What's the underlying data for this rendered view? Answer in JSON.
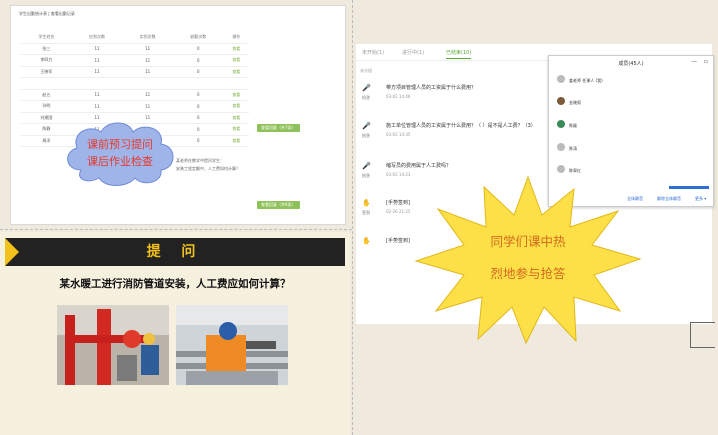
{
  "top_left": {
    "tabs": "学生出勤统计表 | 查看出勤记录",
    "columns": [
      "学生姓名",
      "应到次数",
      "实到次数",
      "缺勤次数",
      "操作"
    ],
    "rows": [
      {
        "name": "张三",
        "a": "11",
        "b": "11",
        "c": "0",
        "act": "查看"
      },
      {
        "name": "李四方",
        "a": "11",
        "b": "11",
        "c": "0",
        "act": "查看"
      },
      {
        "name": "王晓军",
        "a": "11",
        "b": "11",
        "c": "0",
        "act": "查看"
      },
      {
        "name": "",
        "a": "",
        "b": "",
        "c": "",
        "act": ""
      },
      {
        "name": "赵五",
        "a": "11",
        "b": "11",
        "c": "0",
        "act": "查看"
      },
      {
        "name": "孙明",
        "a": "11",
        "b": "11",
        "c": "0",
        "act": "查看"
      },
      {
        "name": "刘建国",
        "a": "11",
        "b": "11",
        "c": "0",
        "act": "查看"
      },
      {
        "name": "陈静",
        "a": "11",
        "b": "11",
        "c": "0",
        "act": "查看"
      },
      {
        "name": "周洋",
        "a": "11",
        "b": "11",
        "c": "0",
        "act": "查看"
      }
    ],
    "cloud_line1": "课前预习提问",
    "cloud_line2": "课后作业检查",
    "reply_button": "查看回复（共7条）",
    "reply_button2": "查看回复（共6条）",
    "comment1": "某老师在教学中提问学生：",
    "comment2": "安装工程定额中，人工费如何计算？"
  },
  "bottom_left": {
    "title": "提 问",
    "question": "某水暖工进行消防管道安装，人工费应如何计算？"
  },
  "right": {
    "tabs": {
      "t1": "未开始(1)",
      "t2": "进行中(1)",
      "t3": "已结束(10)"
    },
    "section_label": "未分组",
    "items": [
      {
        "who": "抢答",
        "text": "带方项目管理人员的工资属于什么费用？",
        "time": "03-02 14:46"
      },
      {
        "who": "抢答",
        "text": "施工单位管理人员的工资属于什么费用？（ ）是不是人工费？（3）",
        "time": "03-02 14:35"
      },
      {
        "who": "抢答",
        "text": "缩写员的费用属于人工费吗？",
        "time": "03-02 14:23"
      },
      {
        "who": "签到",
        "text": "[手势签到]",
        "time": "02-26 21:25"
      },
      {
        "who": "",
        "text": "[手势签到]",
        "time": ""
      }
    ]
  },
  "members": {
    "title": "成员(45人)",
    "list": [
      {
        "name": "姜老师 任课人 (我)"
      },
      {
        "name": "金晓雨"
      },
      {
        "name": "陈磊"
      },
      {
        "name": "陈涛"
      },
      {
        "name": "陈翠红"
      }
    ],
    "buttons": {
      "b1": "全体静音",
      "b2": "解除全体静音",
      "b3": "更多 ▾"
    }
  },
  "star": {
    "line1": "同学们课中热",
    "line2": "烈地参与抢答"
  },
  "colors": {
    "accent": "#7ab341",
    "star": "#fde047",
    "cloud": "#9fb4e9"
  }
}
